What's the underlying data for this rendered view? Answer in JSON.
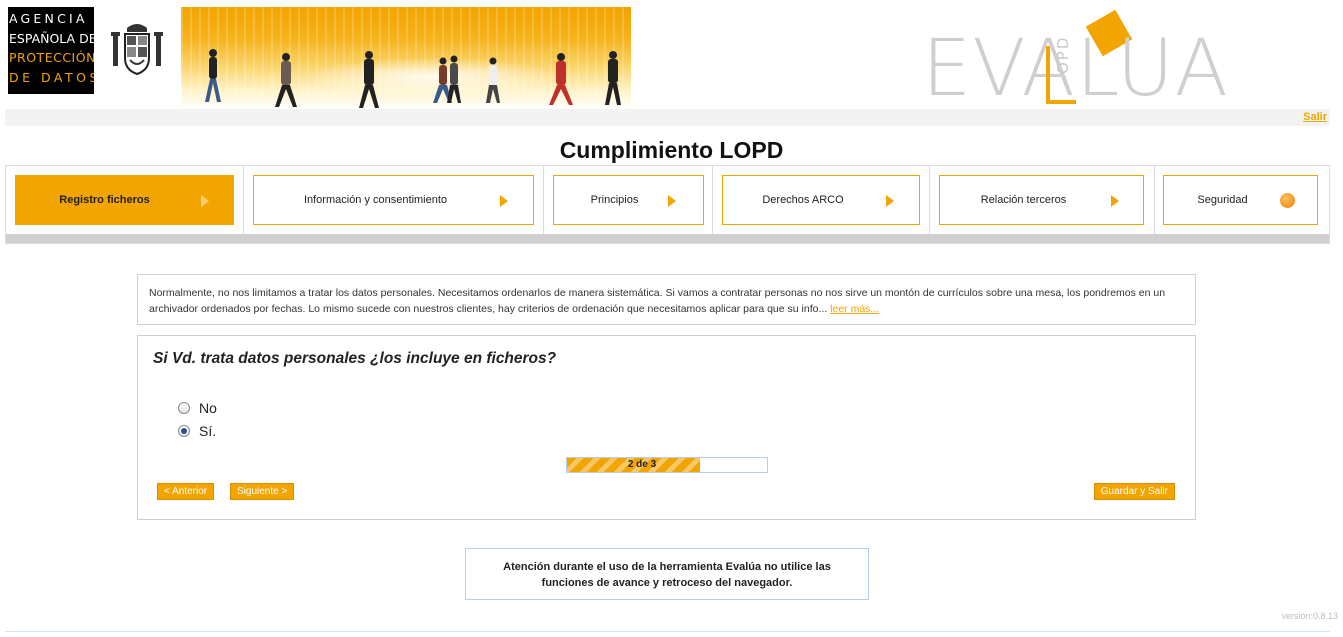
{
  "header": {
    "agency_logo": {
      "lines": [
        "AGENCIA",
        "ESPAÑOLA DE",
        "PROTECCIÓN",
        "DE  DATOS"
      ]
    },
    "crest_icon": "spain-coat-of-arms-icon",
    "banner_image": "walking-people-banner",
    "brand_logo": {
      "word": "EVALUA",
      "badge": "OPD",
      "accent_color": "#f2a400"
    },
    "exit_link": "Salir"
  },
  "page_title": "Cumplimiento LOPD",
  "steps": [
    {
      "label": "Registro ficheros",
      "state": "active",
      "indicator": "arrow-right-icon"
    },
    {
      "label": "Información y consentimiento",
      "state": "pending",
      "indicator": "arrow-right-icon"
    },
    {
      "label": "Principios",
      "state": "pending",
      "indicator": "arrow-right-icon"
    },
    {
      "label": "Derechos ARCO",
      "state": "pending",
      "indicator": "arrow-right-icon"
    },
    {
      "label": "Relación terceros",
      "state": "pending",
      "indicator": "arrow-right-icon"
    },
    {
      "label": "Seguridad",
      "state": "pending",
      "indicator": "circle-dot-icon"
    }
  ],
  "info": {
    "text": "Normalmente, no nos limitamos a tratar los datos personales. Necesitamos ordenarlos de manera sistemática. Si vamos a contratar personas no nos sirve un montón de currículos sobre una mesa, los pondremos en un archivador ordenados por fechas. Lo mismo sucede con nuestros clientes, hay criterios de ordenación que necesitamos aplicar para que su info...",
    "more_link": "leer más..."
  },
  "question": {
    "text": "Si Vd. trata datos personales ¿los incluye en ficheros?",
    "options": [
      {
        "label": "No",
        "checked": false
      },
      {
        "label": "Sí.",
        "checked": true
      }
    ]
  },
  "progress": {
    "text": "2 de 3",
    "current": 2,
    "total": 3
  },
  "buttons": {
    "prev": "< Anterior",
    "next": "Siguiente >",
    "save_exit": "Guardar y Salir"
  },
  "alert": {
    "line1": "Atención durante el uso de la herramienta Evalúa no utilice las",
    "line2": "funciones de avance y retroceso del navegador."
  },
  "version": "versión:0.8.13",
  "colors": {
    "accent": "#f2a400",
    "border": "#cfcfcf",
    "alert_border": "#b7cfe6"
  }
}
